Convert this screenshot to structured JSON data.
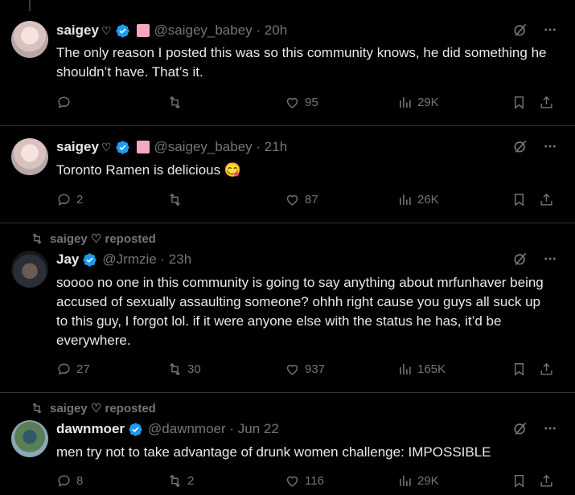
{
  "tweets": [
    {
      "name": "saigey",
      "heart": "♡",
      "handle": "@saigey_babey · 20h",
      "text": "The only reason I posted this was so this community knows, he did something he shouldn’t have. That’s it.",
      "replies": "",
      "reposts": "",
      "likes": "95",
      "views": "29K"
    },
    {
      "name": "saigey",
      "heart": "♡",
      "handle": "@saigey_babey · 21h",
      "text": "Toronto Ramen is delicious 😋",
      "replies": "2",
      "reposts": "",
      "likes": "87",
      "views": "26K"
    },
    {
      "repost_label": "saigey ♡ reposted",
      "name": "Jay",
      "handle": "@Jrmzie · 23h",
      "text": "soooo no one in this community is going to say anything about mrfunhaver being accused of sexually assaulting someone? ohhh right cause you guys all suck up to this guy, I forgot lol. if it were anyone else with the status he has, it’d be everywhere.",
      "replies": "27",
      "reposts": "30",
      "likes": "937",
      "views": "165K"
    },
    {
      "repost_label": "saigey ♡ reposted",
      "name": "dawnmoer",
      "handle": "@dawnmoer · Jun 22",
      "text": "men try not to take advantage of drunk women challenge: IMPOSSIBLE",
      "replies": "8",
      "reposts": "2",
      "likes": "116",
      "views": "29K"
    }
  ],
  "colors": {
    "accent": "#1d9bf0",
    "muted": "#71767b",
    "background": "#000000",
    "text": "#e7e9ea"
  }
}
